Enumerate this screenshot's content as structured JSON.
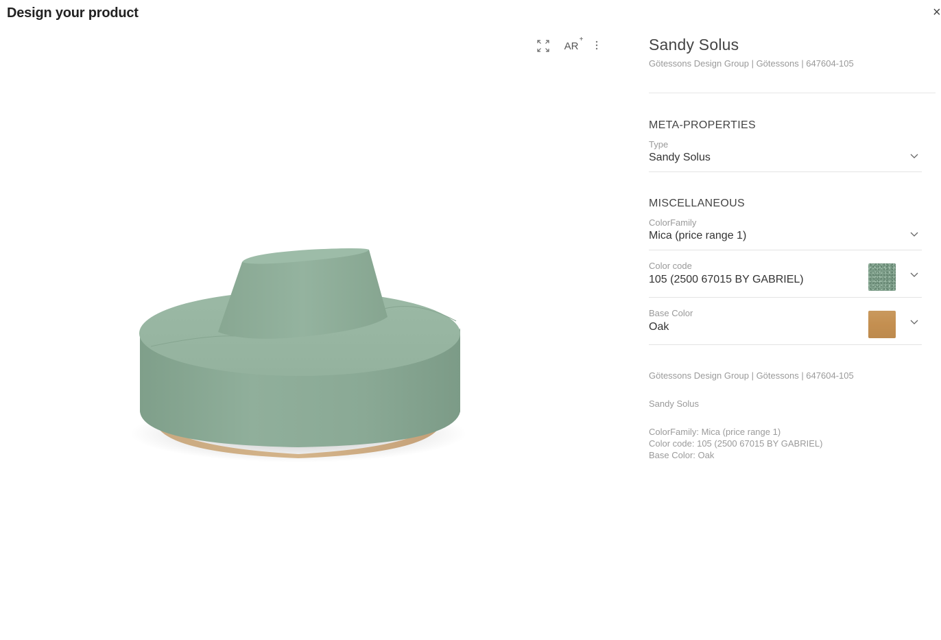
{
  "dialog": {
    "title": "Design your product",
    "close_label": "×"
  },
  "viewer": {
    "ar_label": "AR",
    "ar_plus": "+"
  },
  "product": {
    "name": "Sandy Solus",
    "subtitle": "Götessons Design Group | Götessons | 647604-105"
  },
  "sections": {
    "meta": {
      "title": "META-PROPERTIES",
      "properties": [
        {
          "label": "Type",
          "value": "Sandy Solus"
        }
      ]
    },
    "misc": {
      "title": "MISCELLANEOUS",
      "properties": [
        {
          "label": "ColorFamily",
          "value": "Mica (price range 1)"
        },
        {
          "label": "Color code",
          "value": "105 (2500 67015 BY GABRIEL)",
          "swatch": "fabric-green"
        },
        {
          "label": "Base Color",
          "value": "Oak",
          "swatch": "oak-wood"
        }
      ]
    }
  },
  "summary": {
    "line_brand": "Götessons Design Group | Götessons | 647604-105",
    "line_name": "Sandy Solus",
    "details": [
      "ColorFamily: Mica (price range 1)",
      "Color code: 105 (2500 67015 BY GABRIEL)",
      "Base Color: Oak"
    ]
  },
  "colors": {
    "fabric": "#8fae99",
    "oak": "#c9995e"
  },
  "icons": [
    "fullscreen-icon",
    "ar-icon",
    "more-vertical-icon",
    "chevron-down-icon",
    "close-icon"
  ]
}
